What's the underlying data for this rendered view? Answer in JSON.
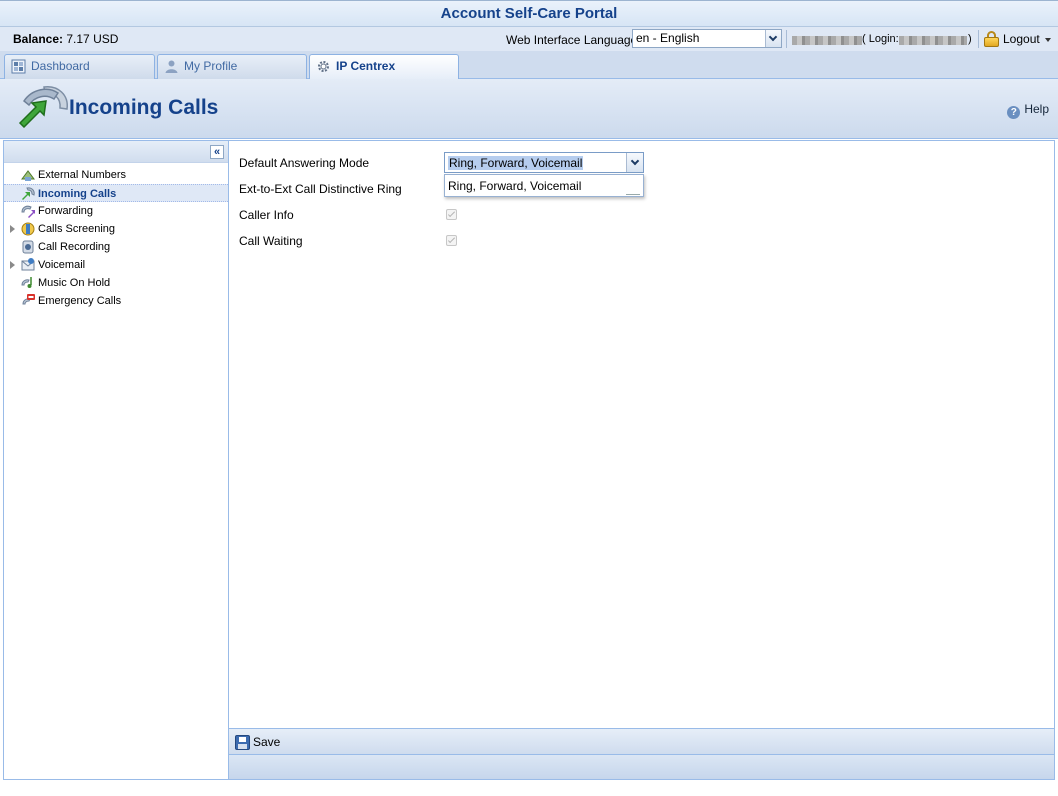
{
  "title": "Account Self-Care Portal",
  "infobar": {
    "balance_label": "Balance:",
    "balance_value": "7.17 USD",
    "language_label": "Web Interface Language:",
    "language_value": "en - English",
    "login_open": "( Login:",
    "login_close": ")",
    "logout_label": "Logout"
  },
  "tabs": [
    {
      "label": "Dashboard",
      "icon": "dashboard-icon"
    },
    {
      "label": "My Profile",
      "icon": "user-icon"
    },
    {
      "label": "IP Centrex",
      "icon": "gear-icon",
      "active": true
    }
  ],
  "header": {
    "title": "Incoming Calls",
    "help_label": "Help"
  },
  "sidebar": {
    "collapse_glyph": "«",
    "items": [
      {
        "label": "External Numbers",
        "icon": "external-numbers-icon"
      },
      {
        "label": "Incoming Calls",
        "icon": "incoming-calls-icon",
        "selected": true
      },
      {
        "label": "Forwarding",
        "icon": "forwarding-icon"
      },
      {
        "label": "Calls Screening",
        "icon": "calls-screening-icon",
        "expandable": true
      },
      {
        "label": "Call Recording",
        "icon": "call-recording-icon"
      },
      {
        "label": "Voicemail",
        "icon": "voicemail-icon",
        "expandable": true
      },
      {
        "label": "Music On Hold",
        "icon": "music-on-hold-icon"
      },
      {
        "label": "Emergency Calls",
        "icon": "emergency-calls-icon"
      }
    ]
  },
  "form": {
    "default_answering_mode_label": "Default Answering Mode",
    "default_answering_mode_value": "Ring, Forward, Voicemail",
    "dropdown_options": [
      "Ring, Forward, Voicemail"
    ],
    "distinctive_ring_label": "Ext-to-Ext Call Distinctive Ring",
    "caller_info_label": "Caller Info",
    "caller_info_checked": true,
    "call_waiting_label": "Call Waiting",
    "call_waiting_checked": true
  },
  "toolbar": {
    "save_label": "Save"
  },
  "colors": {
    "accent": "#15428b",
    "border": "#99bbe8",
    "panel": "#dfe8f5"
  }
}
